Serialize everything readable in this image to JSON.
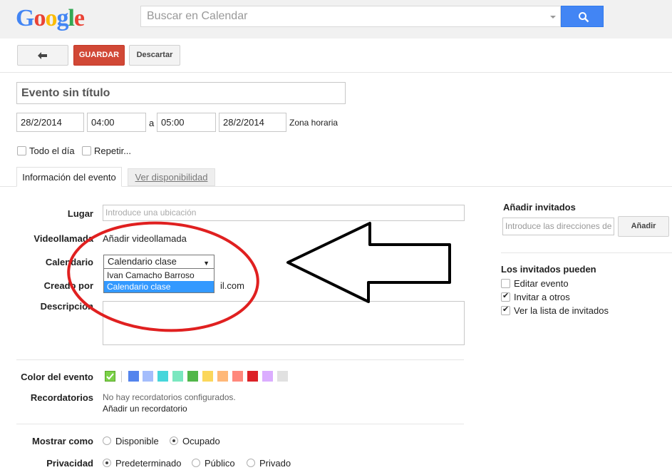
{
  "header": {
    "logo": [
      "G",
      "o",
      "o",
      "g",
      "l",
      "e"
    ],
    "logo_colors": [
      "#4285f4",
      "#ea4335",
      "#fbbc05",
      "#4285f4",
      "#34a853",
      "#ea4335"
    ],
    "search_placeholder": "Buscar en Calendar",
    "search_button_color": "#4285f4"
  },
  "toolbar": {
    "back_icon": "back-arrow-icon",
    "save_label": "GUARDAR",
    "discard_label": "Descartar"
  },
  "event": {
    "title_placeholder": "Evento sin título",
    "start_date": "28/2/2014",
    "start_time": "04:00",
    "to_label": "a",
    "end_time": "05:00",
    "end_date": "28/2/2014",
    "timezone_link": "Zona horaria",
    "all_day_label": "Todo el día",
    "repeat_label": "Repetir..."
  },
  "tabs": {
    "info": "Información del evento",
    "availability": "Ver disponibilidad"
  },
  "details": {
    "where_label": "Lugar",
    "where_placeholder": "Introduce una ubicación",
    "video_label": "Videollamada",
    "video_link": "Añadir videollamada",
    "calendar_label": "Calendario",
    "calendar_value": "Calendario clase",
    "calendar_options": [
      "Ivan Camacho Barroso",
      "Calendario clase"
    ],
    "created_by_label": "Creado por",
    "created_by_value": "il.com",
    "description_label": "Descripción"
  },
  "color": {
    "label": "Color del evento",
    "swatches": [
      "#7bd148",
      "#5484ed",
      "#a4bdfc",
      "#46d6db",
      "#7ae7bf",
      "#51b749",
      "#fbd75b",
      "#ffb878",
      "#ff887c",
      "#dc2127",
      "#dbadff",
      "#e1e1e1"
    ]
  },
  "reminders": {
    "label": "Recordatorios",
    "none_text": "No hay recordatorios configurados.",
    "add_link": "Añadir un recordatorio"
  },
  "show_as": {
    "label": "Mostrar como",
    "options": [
      "Disponible",
      "Ocupado"
    ],
    "selected": "Ocupado"
  },
  "privacy": {
    "label": "Privacidad",
    "options": [
      "Predeterminado",
      "Público",
      "Privado"
    ],
    "selected": "Predeterminado"
  },
  "guests": {
    "title": "Añadir invitados",
    "input_placeholder": "Introduce las direcciones de correo",
    "add_button": "Añadir",
    "permissions_title": "Los invitados pueden",
    "permissions": [
      {
        "label": "Editar evento",
        "checked": false
      },
      {
        "label": "Invitar a otros",
        "checked": true
      },
      {
        "label": "Ver la lista de invitados",
        "checked": true
      }
    ]
  },
  "annotation": {
    "ellipse_color": "#e02020",
    "arrow_color": "#000000"
  }
}
